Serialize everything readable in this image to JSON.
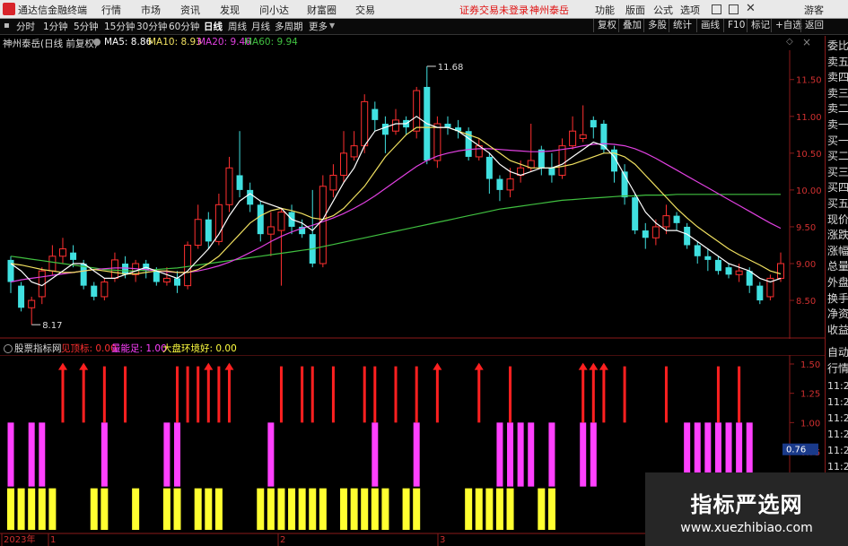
{
  "app": {
    "title": "通达信金融终端"
  },
  "menu": [
    "行情",
    "市场",
    "资讯",
    "发现",
    "问小达",
    "财富圈",
    "交易"
  ],
  "account_status": "证券交易未登录",
  "stock_name_top": "神州泰岳",
  "top_right": [
    "功能",
    "版面",
    "公式",
    "选项"
  ],
  "guest": "游客",
  "periods": [
    "分时",
    "1分钟",
    "5分钟",
    "15分钟",
    "30分钟",
    "60分钟",
    "日线",
    "周线",
    "月线",
    "多周期",
    "更多"
  ],
  "active_period": "日线",
  "toolbar_right": [
    "复权",
    "叠加",
    "多股",
    "统计",
    "画线",
    "F10",
    "标记",
    "+自选",
    "返回"
  ],
  "main_chart": {
    "title": "神州泰岳(日线 前复权)",
    "ma": [
      {
        "label": "MA5: 8.86",
        "color": "#ffffff"
      },
      {
        "label": "MA10: 8.93",
        "color": "#f0e060"
      },
      {
        "label": "MA20: 9.46",
        "color": "#e040e0"
      },
      {
        "label": "MA60: 9.94",
        "color": "#40c040"
      }
    ],
    "high_label": "11.68",
    "low_label": "8.17",
    "y_ticks": [
      "11.50",
      "11.00",
      "10.50",
      "10.00",
      "9.50",
      "9.00",
      "8.50"
    ]
  },
  "indicator": {
    "name": "股票指标网",
    "items": [
      {
        "label": "见顶标: 0.00",
        "color": "#ff3030"
      },
      {
        "label": "量能足: 1.00",
        "color": "#ff40ff"
      },
      {
        "label": "大盘环境好: 0.00",
        "color": "#ffff40"
      }
    ],
    "y_ticks": [
      "1.50",
      "1.25",
      "1.00",
      "0.75"
    ],
    "current_value": "0.76"
  },
  "right_panel": {
    "labels": [
      "委比",
      "卖五",
      "卖四",
      "卖三",
      "卖二",
      "卖一",
      "买一",
      "买二",
      "买三",
      "买四",
      "买五",
      "现价",
      "涨跌",
      "涨幅",
      "总量",
      "外盘",
      "换手",
      "净资",
      "收益"
    ],
    "lower": [
      "自动",
      "行情"
    ],
    "times": [
      "11:2",
      "11:2",
      "11:2",
      "11:2",
      "11:2",
      "11:2",
      "11:2"
    ]
  },
  "x_labels": [
    "2023年",
    "1",
    "2",
    "3"
  ],
  "watermark": {
    "title": "指标严选网",
    "url": "www.xuezhibiao.com"
  },
  "colors": {
    "up": "#ff3030",
    "down": "#40e0e0",
    "ma5": "#ffffff",
    "ma10": "#f0e060",
    "ma20": "#e040e0",
    "ma60": "#40c040",
    "signal_top": "#ff2020",
    "signal_volume": "#ff40ff",
    "signal_market": "#ffff30"
  },
  "chart_data": {
    "type": "candlestick",
    "price_range": [
      8.17,
      11.68
    ],
    "candles": [
      [
        9.05,
        8.75,
        9.1,
        8.6
      ],
      [
        8.7,
        8.4,
        8.75,
        8.35
      ],
      [
        8.4,
        8.5,
        8.55,
        8.17
      ],
      [
        8.55,
        8.9,
        8.95,
        8.45
      ],
      [
        8.9,
        9.1,
        9.25,
        8.85
      ],
      [
        9.1,
        9.2,
        9.35,
        9.0
      ],
      [
        9.15,
        9.05,
        9.25,
        8.95
      ],
      [
        9.0,
        8.7,
        9.05,
        8.65
      ],
      [
        8.7,
        8.55,
        8.75,
        8.5
      ],
      [
        8.55,
        8.75,
        8.8,
        8.5
      ],
      [
        8.8,
        9.05,
        9.15,
        8.75
      ],
      [
        9.0,
        8.85,
        9.1,
        8.8
      ],
      [
        8.85,
        9.0,
        9.05,
        8.75
      ],
      [
        9.0,
        8.9,
        9.05,
        8.8
      ],
      [
        8.9,
        8.75,
        8.95,
        8.7
      ],
      [
        8.75,
        8.8,
        8.95,
        8.7
      ],
      [
        8.8,
        8.7,
        8.9,
        8.6
      ],
      [
        8.7,
        9.25,
        9.3,
        8.65
      ],
      [
        9.25,
        9.6,
        9.8,
        9.2
      ],
      [
        9.6,
        9.3,
        9.7,
        9.2
      ],
      [
        9.3,
        9.8,
        9.95,
        9.25
      ],
      [
        9.8,
        10.3,
        10.45,
        9.7
      ],
      [
        10.2,
        10.0,
        10.8,
        9.9
      ],
      [
        10.0,
        9.8,
        10.1,
        9.7
      ],
      [
        9.8,
        9.4,
        9.85,
        9.3
      ],
      [
        9.4,
        9.5,
        9.7,
        9.1
      ],
      [
        9.45,
        9.7,
        9.75,
        8.7
      ],
      [
        9.7,
        9.5,
        9.8,
        9.4
      ],
      [
        9.5,
        9.4,
        9.6,
        9.35
      ],
      [
        9.4,
        9.0,
        10.0,
        8.95
      ],
      [
        9.0,
        10.05,
        10.2,
        8.95
      ],
      [
        10.0,
        10.2,
        10.35,
        9.9
      ],
      [
        10.2,
        10.5,
        10.8,
        10.1
      ],
      [
        10.45,
        10.6,
        10.8,
        10.4
      ],
      [
        10.6,
        11.2,
        11.3,
        10.5
      ],
      [
        11.1,
        10.95,
        11.2,
        10.8
      ],
      [
        10.9,
        10.75,
        11.0,
        10.5
      ],
      [
        10.8,
        10.95,
        11.1,
        10.75
      ],
      [
        10.95,
        10.85,
        11.0,
        10.75
      ],
      [
        10.8,
        11.35,
        11.4,
        10.7
      ],
      [
        11.4,
        10.4,
        11.68,
        10.35
      ],
      [
        10.4,
        10.9,
        11.0,
        10.3
      ],
      [
        10.9,
        10.85,
        11.0,
        10.75
      ],
      [
        10.85,
        10.8,
        10.95,
        10.7
      ],
      [
        10.8,
        10.45,
        10.85,
        10.4
      ],
      [
        10.45,
        10.6,
        10.7,
        10.4
      ],
      [
        10.45,
        10.15,
        10.5,
        9.95
      ],
      [
        10.15,
        10.0,
        10.2,
        9.85
      ],
      [
        10.0,
        10.15,
        10.3,
        9.9
      ],
      [
        10.2,
        10.3,
        10.4,
        10.1
      ],
      [
        10.3,
        10.4,
        10.9,
        10.25
      ],
      [
        10.55,
        10.3,
        10.6,
        10.2
      ],
      [
        10.3,
        10.2,
        10.5,
        10.1
      ],
      [
        10.2,
        10.6,
        10.7,
        10.15
      ],
      [
        10.6,
        10.8,
        11.0,
        10.55
      ],
      [
        10.7,
        10.75,
        11.15,
        10.65
      ],
      [
        10.95,
        10.85,
        11.0,
        10.7
      ],
      [
        10.9,
        10.55,
        10.95,
        10.5
      ],
      [
        10.55,
        10.25,
        10.6,
        10.1
      ],
      [
        10.25,
        9.9,
        10.35,
        9.8
      ],
      [
        9.9,
        9.45,
        9.95,
        9.4
      ],
      [
        9.45,
        9.35,
        9.55,
        9.2
      ],
      [
        9.35,
        9.5,
        9.6,
        9.25
      ],
      [
        9.5,
        9.65,
        9.8,
        9.4
      ],
      [
        9.65,
        9.55,
        9.7,
        9.45
      ],
      [
        9.5,
        9.25,
        9.55,
        9.2
      ],
      [
        9.25,
        9.1,
        9.3,
        9.0
      ],
      [
        9.1,
        9.05,
        9.2,
        8.9
      ],
      [
        9.05,
        8.9,
        9.1,
        8.85
      ],
      [
        8.95,
        8.85,
        9.0,
        8.8
      ],
      [
        8.85,
        8.9,
        9.0,
        8.75
      ],
      [
        8.9,
        8.7,
        8.95,
        8.6
      ],
      [
        8.7,
        8.5,
        8.75,
        8.45
      ],
      [
        8.55,
        8.8,
        8.85,
        8.5
      ],
      [
        8.8,
        9.0,
        9.15,
        8.75
      ]
    ],
    "ma5": [
      9.0,
      8.9,
      8.75,
      8.7,
      8.8,
      8.9,
      9.0,
      9.0,
      8.9,
      8.8,
      8.8,
      8.85,
      8.9,
      8.95,
      8.9,
      8.85,
      8.8,
      8.9,
      9.05,
      9.2,
      9.4,
      9.65,
      9.85,
      9.95,
      9.85,
      9.8,
      9.75,
      9.6,
      9.55,
      9.45,
      9.6,
      9.85,
      10.1,
      10.3,
      10.6,
      10.8,
      10.85,
      10.9,
      10.9,
      11.0,
      10.9,
      10.85,
      10.85,
      10.8,
      10.7,
      10.6,
      10.5,
      10.35,
      10.25,
      10.2,
      10.25,
      10.3,
      10.3,
      10.35,
      10.45,
      10.55,
      10.65,
      10.6,
      10.45,
      10.2,
      9.95,
      9.7,
      9.55,
      9.45,
      9.45,
      9.4,
      9.3,
      9.2,
      9.1,
      9.0,
      8.95,
      8.9,
      8.8,
      8.75,
      8.8
    ],
    "ma10": [
      9.0,
      8.98,
      8.95,
      8.92,
      8.9,
      8.88,
      8.88,
      8.9,
      8.92,
      8.9,
      8.88,
      8.86,
      8.86,
      8.88,
      8.9,
      8.9,
      8.88,
      8.88,
      8.92,
      9.0,
      9.1,
      9.25,
      9.4,
      9.55,
      9.65,
      9.72,
      9.75,
      9.72,
      9.68,
      9.62,
      9.6,
      9.65,
      9.75,
      9.9,
      10.05,
      10.25,
      10.45,
      10.6,
      10.75,
      10.85,
      10.85,
      10.85,
      10.85,
      10.8,
      10.75,
      10.7,
      10.6,
      10.5,
      10.4,
      10.35,
      10.3,
      10.3,
      10.3,
      10.32,
      10.35,
      10.4,
      10.45,
      10.5,
      10.5,
      10.45,
      10.35,
      10.2,
      10.05,
      9.9,
      9.75,
      9.62,
      9.5,
      9.4,
      9.3,
      9.2,
      9.12,
      9.05,
      8.98,
      8.9,
      8.86
    ],
    "ma20": [
      8.75,
      8.78,
      8.8,
      8.82,
      8.84,
      8.86,
      8.88,
      8.9,
      8.92,
      8.93,
      8.94,
      8.94,
      8.93,
      8.92,
      8.9,
      8.89,
      8.88,
      8.88,
      8.9,
      8.93,
      8.97,
      9.02,
      9.08,
      9.15,
      9.22,
      9.3,
      9.37,
      9.43,
      9.48,
      9.52,
      9.57,
      9.62,
      9.68,
      9.75,
      9.83,
      9.92,
      10.02,
      10.12,
      10.22,
      10.32,
      10.4,
      10.46,
      10.5,
      10.53,
      10.55,
      10.56,
      10.56,
      10.55,
      10.54,
      10.53,
      10.52,
      10.52,
      10.53,
      10.55,
      10.57,
      10.6,
      10.62,
      10.63,
      10.62,
      10.6,
      10.56,
      10.5,
      10.43,
      10.35,
      10.27,
      10.19,
      10.11,
      10.03,
      9.95,
      9.87,
      9.79,
      9.71,
      9.63,
      9.55,
      9.48
    ],
    "ma60": [
      9.1,
      9.08,
      9.06,
      9.04,
      9.02,
      9.0,
      8.98,
      8.96,
      8.94,
      8.92,
      8.91,
      8.9,
      8.9,
      8.91,
      8.92,
      8.93,
      8.94,
      8.96,
      8.98,
      9.0,
      9.02,
      9.04,
      9.06,
      9.08,
      9.1,
      9.12,
      9.14,
      9.16,
      9.18,
      9.2,
      9.23,
      9.26,
      9.29,
      9.32,
      9.35,
      9.38,
      9.41,
      9.44,
      9.47,
      9.5,
      9.53,
      9.56,
      9.59,
      9.62,
      9.65,
      9.68,
      9.71,
      9.74,
      9.76,
      9.78,
      9.8,
      9.82,
      9.84,
      9.86,
      9.87,
      9.88,
      9.89,
      9.9,
      9.91,
      9.92,
      9.92,
      9.93,
      9.93,
      9.93,
      9.94,
      9.94,
      9.94,
      9.94,
      9.94,
      9.94,
      9.94,
      9.94,
      9.94,
      9.94,
      9.94
    ],
    "signal_top": [
      5,
      7,
      9,
      11,
      16,
      17,
      18,
      19,
      20,
      21,
      26,
      28,
      29,
      31,
      34,
      35,
      37,
      39,
      41,
      45,
      48,
      55,
      56,
      57,
      59,
      63,
      68,
      70
    ],
    "signal_volume_top": [
      5,
      7,
      19,
      21,
      41,
      45,
      55,
      56,
      57
    ],
    "signal_volume": [
      0,
      2,
      3,
      9,
      15,
      16,
      25,
      35,
      39,
      47,
      48,
      49,
      50,
      52,
      55,
      56,
      65,
      66,
      67,
      68,
      69,
      70,
      71
    ],
    "signal_market": [
      0,
      1,
      2,
      3,
      4,
      8,
      9,
      12,
      15,
      16,
      18,
      19,
      20,
      24,
      25,
      26,
      27,
      28,
      29,
      30,
      32,
      33,
      34,
      35,
      36,
      38,
      39,
      44,
      45,
      46,
      47,
      48,
      51,
      52
    ]
  }
}
